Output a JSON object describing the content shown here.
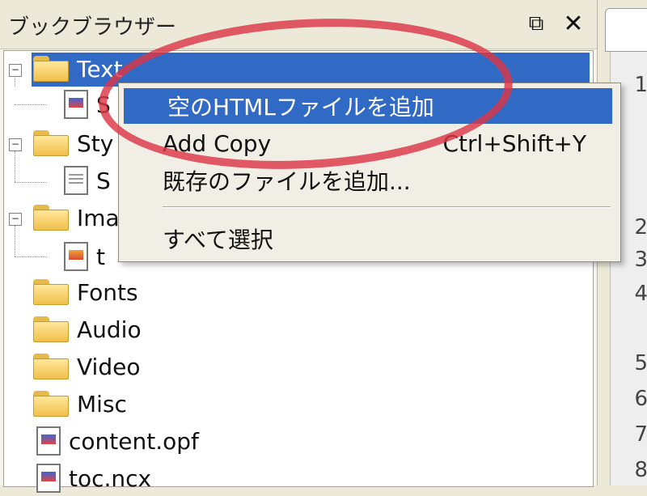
{
  "panel": {
    "title": "ブックブラウザー",
    "float_icon": "float-window-icon",
    "close_icon": "close-icon"
  },
  "tree": {
    "items": [
      {
        "label": "Text",
        "icon": "folder-icon",
        "expanded": true,
        "selected": true
      },
      {
        "label": "S",
        "icon": "html-file-icon",
        "child": true
      },
      {
        "label": "Sty",
        "icon": "folder-icon",
        "expanded": true
      },
      {
        "label": "S",
        "icon": "css-file-icon",
        "child": true
      },
      {
        "label": "Ima",
        "icon": "folder-icon",
        "expanded": true
      },
      {
        "label": "t",
        "icon": "image-file-icon",
        "child": true
      },
      {
        "label": "Fonts",
        "icon": "folder-icon"
      },
      {
        "label": "Audio",
        "icon": "folder-icon"
      },
      {
        "label": "Video",
        "icon": "folder-icon"
      },
      {
        "label": "Misc",
        "icon": "folder-icon"
      },
      {
        "label": "content.opf",
        "icon": "opf-file-icon"
      },
      {
        "label": "toc.ncx",
        "icon": "ncx-file-icon"
      }
    ]
  },
  "context_menu": {
    "items": [
      {
        "label": "空のHTMLファイルを追加",
        "shortcut": "",
        "highlighted": true
      },
      {
        "label": "Add Copy",
        "shortcut": "Ctrl+Shift+Y"
      },
      {
        "label": "既存のファイルを追加...",
        "shortcut": ""
      },
      {
        "label": "すべて選択",
        "shortcut": ""
      }
    ]
  },
  "editor": {
    "line_numbers": [
      "1",
      "2",
      "3",
      "4",
      "5",
      "6",
      "7",
      "8"
    ]
  },
  "colors": {
    "selection": "#316ac5",
    "annotation_ring": "#dc3746",
    "panel_bg": "#ece9d8"
  }
}
